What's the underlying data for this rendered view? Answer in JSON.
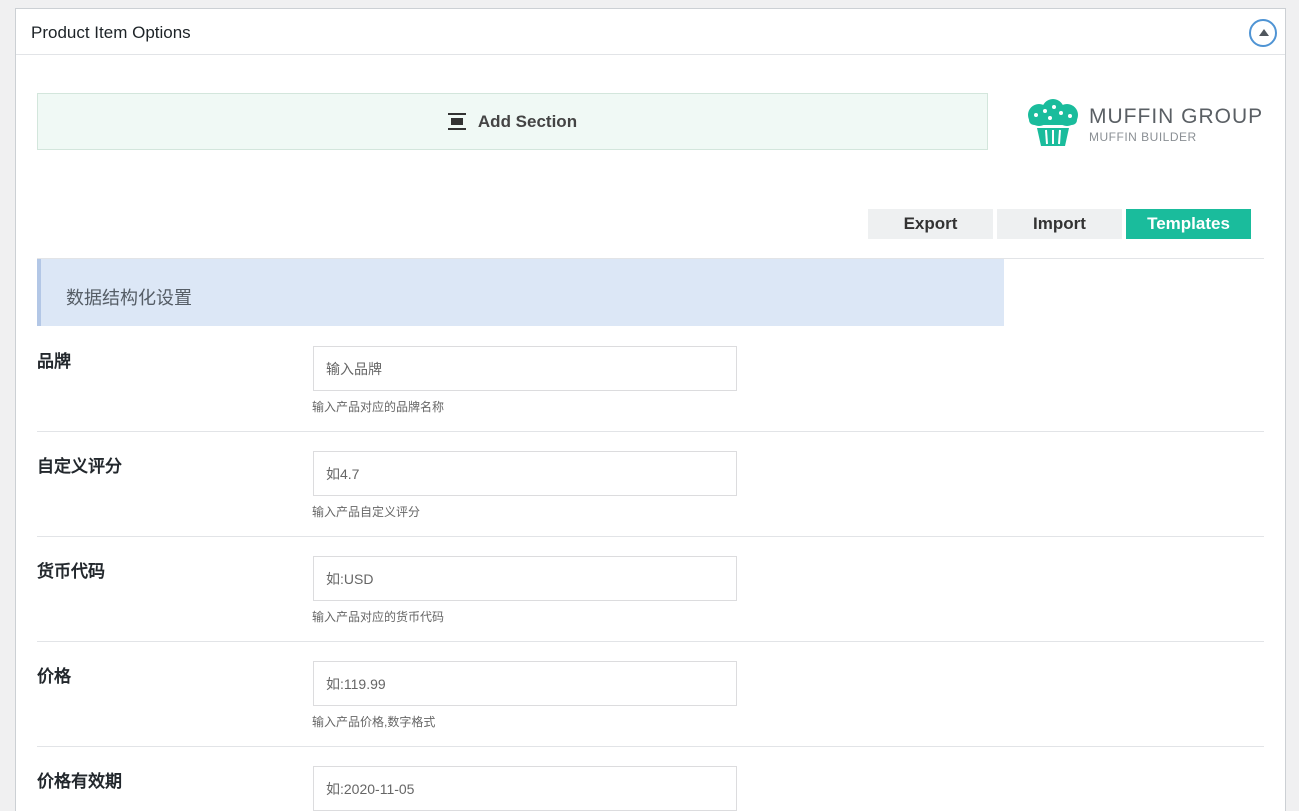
{
  "metabox": {
    "title": "Product Item Options"
  },
  "builder": {
    "add_section_label": "Add Section",
    "logo_title": "MUFFIN GROUP",
    "logo_subtitle": "MUFFIN BUILDER",
    "logo_color": "#1abc9c"
  },
  "toolbar": {
    "export_label": "Export",
    "import_label": "Import",
    "templates_label": "Templates",
    "accent_color": "#1abc9c"
  },
  "section": {
    "title": "数据结构化设置"
  },
  "fields": [
    {
      "label": "品牌",
      "placeholder": "输入品牌",
      "description": "输入产品对应的品牌名称"
    },
    {
      "label": "自定义评分",
      "placeholder": "如4.7",
      "description": "输入产品自定义评分"
    },
    {
      "label": "货币代码",
      "placeholder": "如:USD",
      "description": "输入产品对应的货币代码"
    },
    {
      "label": "价格",
      "placeholder": "如:119.99",
      "description": "输入产品价格,数字格式"
    },
    {
      "label": "价格有效期",
      "placeholder": "如:2020-11-05",
      "description": ""
    }
  ]
}
